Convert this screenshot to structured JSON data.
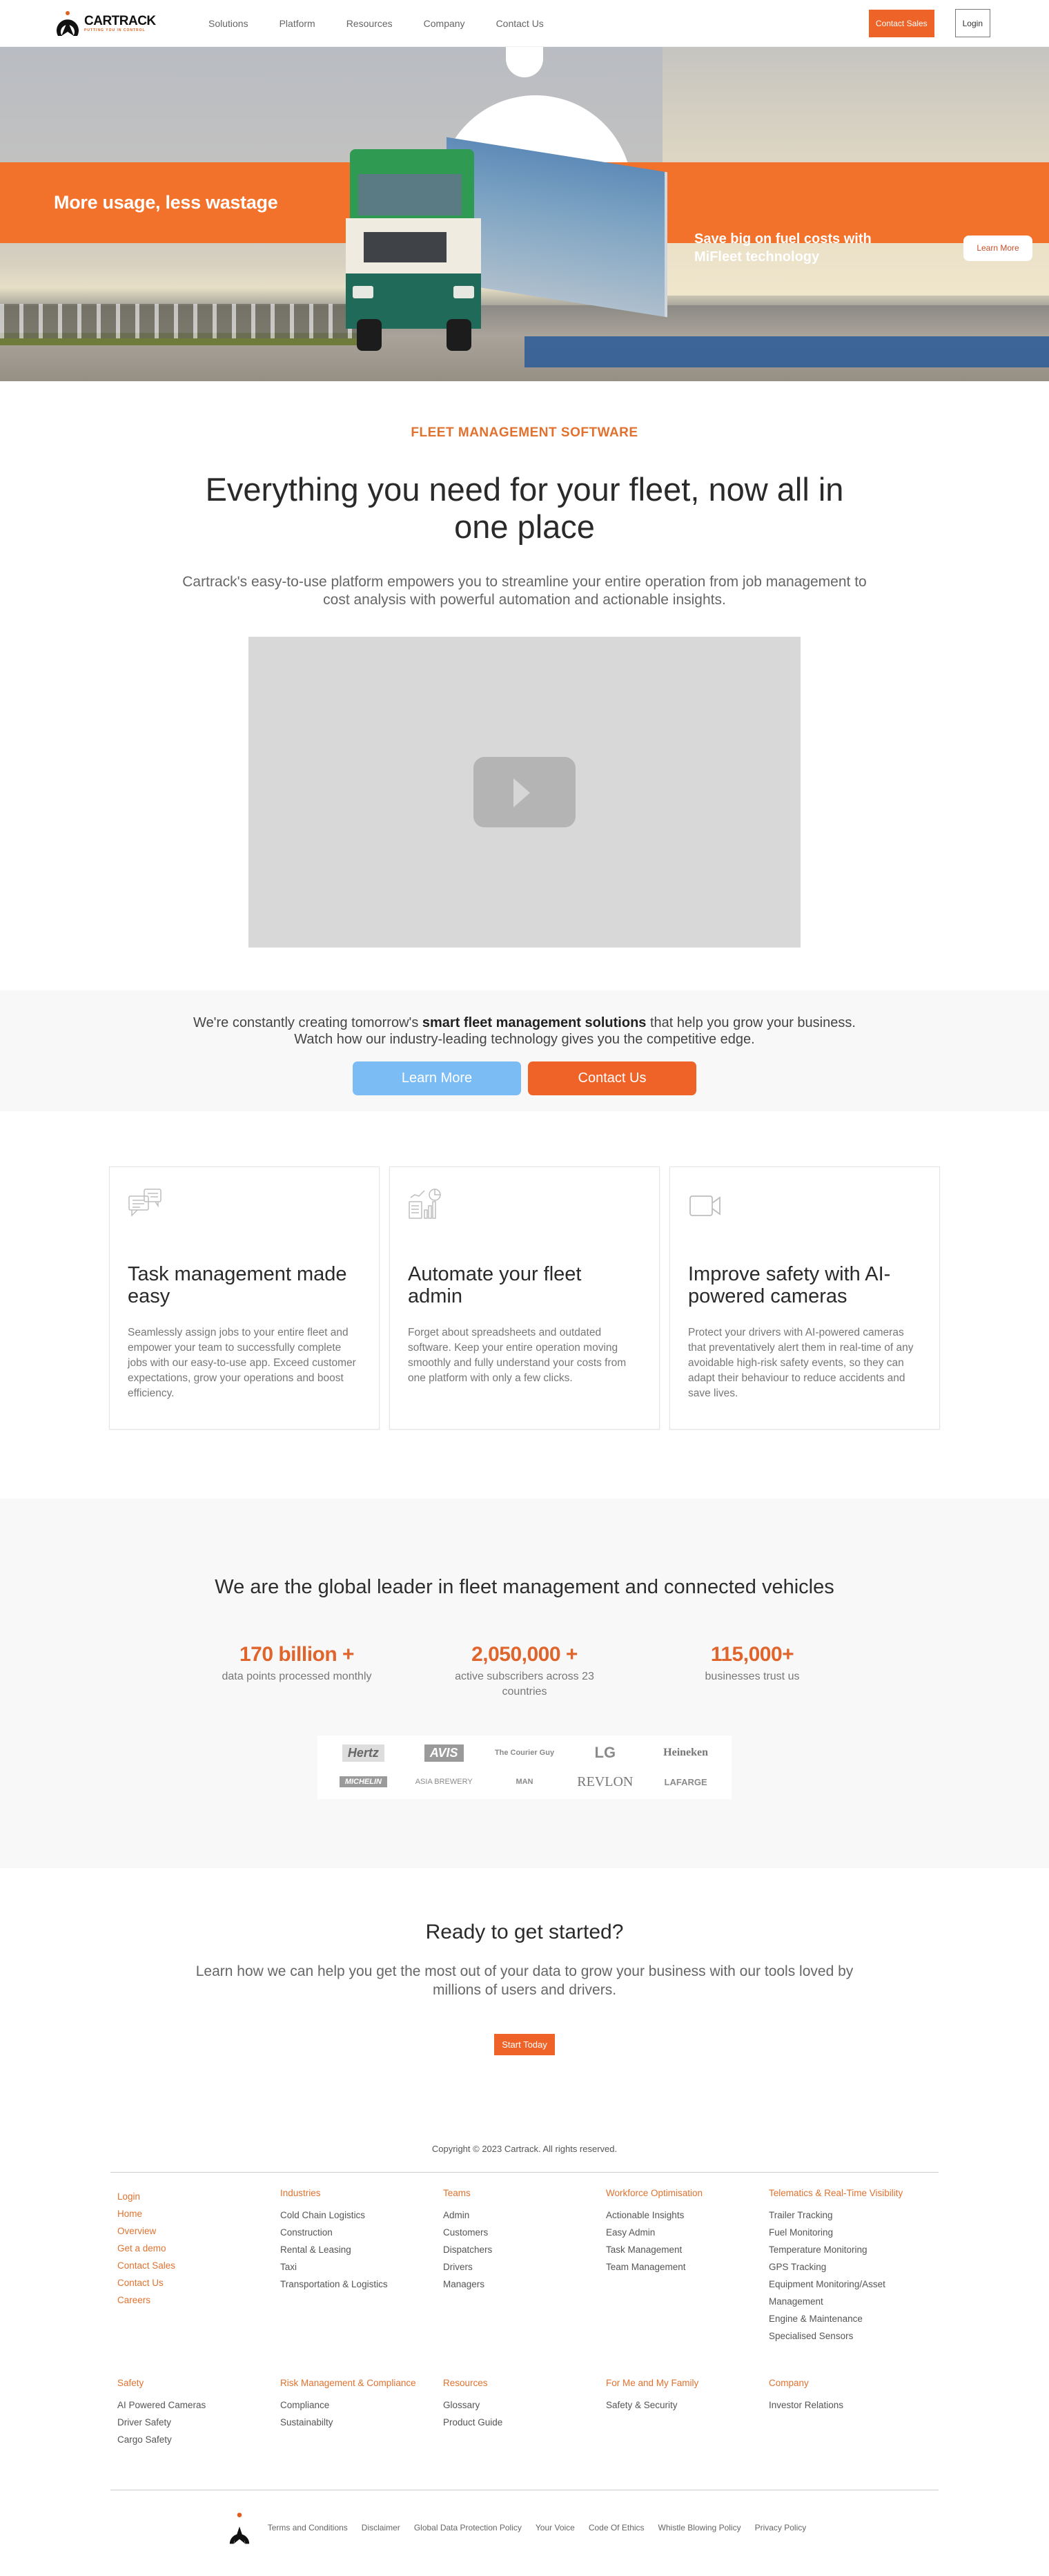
{
  "header": {
    "logo": {
      "name": "CARTRACK",
      "tagline": "PUTTING YOU IN CONTROL"
    },
    "nav": [
      "Solutions",
      "Platform",
      "Resources",
      "Company",
      "Contact Us"
    ],
    "contact_sales_label": "Contact Sales",
    "login_label": "Login"
  },
  "hero": {
    "left_headline": "More usage, less wastage",
    "right_headline": "Save big on fuel costs with MiFleet technology",
    "learn_more_label": "Learn More",
    "slides_total": 3,
    "active_slide": 2
  },
  "intro": {
    "eyebrow": "FLEET MANAGEMENT SOFTWARE",
    "title": "Everything you need for your fleet, now all in one place",
    "subtitle": "Cartrack's easy-to-use platform empowers you to streamline your entire operation from job management to cost analysis with powerful automation and actionable insights.",
    "video_icon": "play-icon"
  },
  "edge": {
    "text_before": "We're constantly creating tomorrow's ",
    "text_bold": "smart fleet management solutions",
    "text_after": " that help you grow your business.",
    "line2": "Watch how our industry-leading technology gives you the competitive edge.",
    "learn_more_label": "Learn More",
    "contact_us_label": "Contact Us"
  },
  "features": [
    {
      "icon": "chat-bubbles-icon",
      "title": "Task management made easy",
      "text": "Seamlessly assign jobs to your entire fleet and empower your team to successfully complete jobs with our easy-to-use app. Exceed customer expectations, grow your operations and boost efficiency."
    },
    {
      "icon": "analytics-report-icon",
      "title": "Automate your fleet admin",
      "text": "Forget about spreadsheets and outdated software. Keep your entire operation moving smoothly and fully understand your costs from one platform with only a few clicks."
    },
    {
      "icon": "video-camera-icon",
      "title": "Improve safety with AI-powered cameras",
      "text": "Protect your drivers with AI-powered cameras that preventatively alert them in real-time of any avoidable high-risk safety events, so they can adapt their behaviour to reduce accidents and save lives."
    }
  ],
  "stats": {
    "title": "We are the global leader in fleet management and connected vehicles",
    "items": [
      {
        "value": "170 billion +",
        "label": "data points processed monthly"
      },
      {
        "value": "2,050,000 +",
        "label": "active subscribers across 23 countries"
      },
      {
        "value": "115,000+",
        "label": "businesses trust us"
      }
    ],
    "brands": [
      "Hertz",
      "AVIS",
      "The Courier Guy",
      "LG",
      "Heineken",
      "MICHELIN",
      "ASIA BREWERY",
      "MAN",
      "REVLON",
      "LAFARGE"
    ]
  },
  "cta": {
    "title": "Ready to get started?",
    "subtitle": "Learn how we can help you get the most out of your data to grow your business with our tools loved by millions of users and drivers.",
    "button_label": "Start Today"
  },
  "footer": {
    "copyright": "Copyright © 2023 Cartrack. All rights reserved.",
    "quick_links": [
      "Login",
      "Home",
      "Overview",
      "Get a demo",
      "Contact Sales",
      "Contact Us",
      "Careers"
    ],
    "columns": [
      {
        "heading": "Industries",
        "links": [
          "Cold Chain Logistics",
          "Construction",
          "Rental & Leasing",
          "Taxi",
          "Transportation & Logistics"
        ]
      },
      {
        "heading": "Teams",
        "links": [
          "Admin",
          "Customers",
          "Dispatchers",
          "Drivers",
          "Managers"
        ]
      },
      {
        "heading": "Workforce Optimisation",
        "links": [
          "Actionable Insights",
          "Easy Admin",
          "Task Management",
          "Team Management"
        ]
      },
      {
        "heading": "Telematics & Real-Time Visibility",
        "links": [
          "Trailer Tracking",
          "Fuel Monitoring",
          "Temperature Monitoring",
          "GPS Tracking",
          "Equipment Monitoring/Asset Management",
          "Engine & Maintenance",
          "Specialised Sensors"
        ]
      },
      {
        "heading": "Safety",
        "links": [
          "AI Powered Cameras",
          "Driver Safety",
          "Cargo Safety"
        ]
      },
      {
        "heading": "Risk Management & Compliance",
        "links": [
          "Compliance",
          "Sustainabilty"
        ]
      },
      {
        "heading": "Resources",
        "links": [
          "Glossary",
          "Product Guide"
        ]
      },
      {
        "heading": "For Me and My Family",
        "links": [
          "Safety & Security"
        ]
      },
      {
        "heading": "Company",
        "links": [
          "Investor Relations"
        ]
      }
    ],
    "legal": [
      "Terms and Conditions",
      "Disclaimer",
      "Global Data Protection Policy",
      "Your Voice",
      "Code Of Ethics",
      "Whistle Blowing Policy",
      "Privacy Policy"
    ]
  },
  "colors": {
    "brand_orange": "#ee6328",
    "accent_blue": "#7bbcf5",
    "heading_orange": "#e0722f"
  }
}
